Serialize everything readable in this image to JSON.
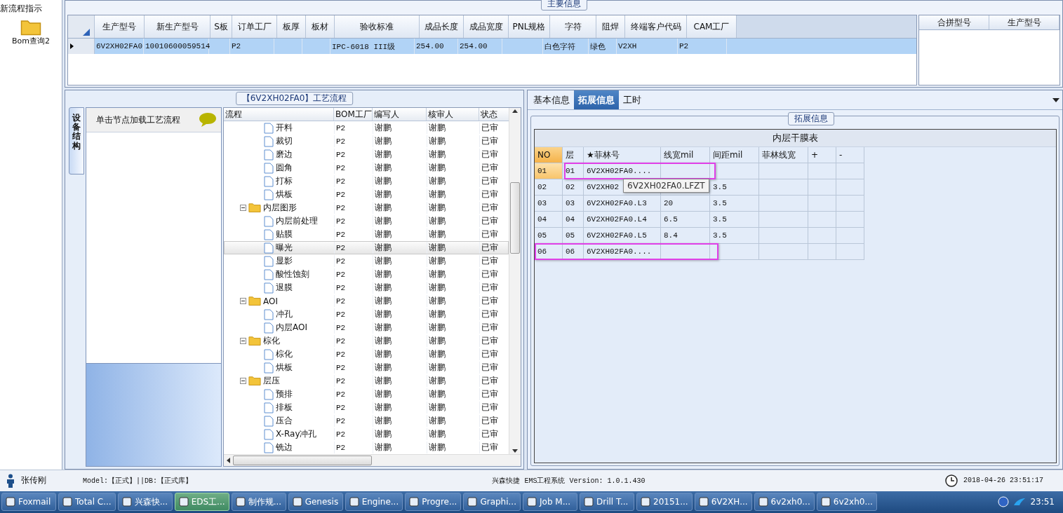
{
  "sidebar": {
    "heading": "新流程指示",
    "items": [
      {
        "label": "Bom查询2"
      }
    ]
  },
  "main_info": {
    "legend": "主要信息",
    "columns": [
      "生产型号",
      "新生产型号",
      "S板",
      "订单工厂",
      "板厚",
      "板材",
      "验收标准",
      "成品长度",
      "成品宽度",
      "PNL规格",
      "字符",
      "阻焊",
      "终端客户代码",
      "CAM工厂"
    ],
    "rows": [
      {
        "selected": true,
        "cells": [
          "6V2XH02FA0",
          "10010600059514",
          null,
          "P2",
          null,
          null,
          "IPC-6018 III级",
          "254.00",
          "254.00",
          null,
          "白色字符",
          "绿色",
          "V2XH",
          "P2"
        ]
      }
    ],
    "side_columns": [
      "合拼型号",
      "生产型号"
    ]
  },
  "process": {
    "legend": "【6V2XH02FA0】工艺流程",
    "side_tab": "设备结构",
    "hint": "单击节点加载工艺流程",
    "columns": [
      "流程",
      "BOM工厂",
      "编写人",
      "核审人",
      "状态"
    ],
    "tree": [
      {
        "kind": "leaf",
        "name": "开料",
        "factory": "P2",
        "author": "谢鹏",
        "reviewer": "谢鹏",
        "status": "已审",
        "selected": false
      },
      {
        "kind": "leaf",
        "name": "裁切",
        "factory": "P2",
        "author": "谢鹏",
        "reviewer": "谢鹏",
        "status": "已审",
        "selected": false
      },
      {
        "kind": "leaf",
        "name": "磨边",
        "factory": "P2",
        "author": "谢鹏",
        "reviewer": "谢鹏",
        "status": "已审",
        "selected": false
      },
      {
        "kind": "leaf",
        "name": "圆角",
        "factory": "P2",
        "author": "谢鹏",
        "reviewer": "谢鹏",
        "status": "已审",
        "selected": false
      },
      {
        "kind": "leaf",
        "name": "打标",
        "factory": "P2",
        "author": "谢鹏",
        "reviewer": "谢鹏",
        "status": "已审",
        "selected": false
      },
      {
        "kind": "leaf",
        "name": "烘板",
        "factory": "P2",
        "author": "谢鹏",
        "reviewer": "谢鹏",
        "status": "已审",
        "selected": false
      },
      {
        "kind": "folder",
        "name": "内层图形",
        "factory": "P2",
        "author": "谢鹏",
        "reviewer": "谢鹏",
        "status": "已审",
        "selected": false,
        "expanded": true,
        "children": [
          {
            "kind": "leaf",
            "name": "内层前处理",
            "factory": "P2",
            "author": "谢鹏",
            "reviewer": "谢鹏",
            "status": "已审",
            "selected": false
          },
          {
            "kind": "leaf",
            "name": "贴膜",
            "factory": "P2",
            "author": "谢鹏",
            "reviewer": "谢鹏",
            "status": "已审",
            "selected": false
          },
          {
            "kind": "leaf",
            "name": "曝光",
            "factory": "P2",
            "author": "谢鹏",
            "reviewer": "谢鹏",
            "status": "已审",
            "selected": true
          },
          {
            "kind": "leaf",
            "name": "显影",
            "factory": "P2",
            "author": "谢鹏",
            "reviewer": "谢鹏",
            "status": "已审",
            "selected": false
          },
          {
            "kind": "leaf",
            "name": "酸性蚀刻",
            "factory": "P2",
            "author": "谢鹏",
            "reviewer": "谢鹏",
            "status": "已审",
            "selected": false
          },
          {
            "kind": "leaf",
            "name": "退膜",
            "factory": "P2",
            "author": "谢鹏",
            "reviewer": "谢鹏",
            "status": "已审",
            "selected": false
          }
        ]
      },
      {
        "kind": "folder",
        "name": "AOI",
        "factory": "P2",
        "author": "谢鹏",
        "reviewer": "谢鹏",
        "status": "已审",
        "selected": false,
        "expanded": true,
        "children": [
          {
            "kind": "leaf",
            "name": "冲孔",
            "factory": "P2",
            "author": "谢鹏",
            "reviewer": "谢鹏",
            "status": "已审",
            "selected": false
          },
          {
            "kind": "leaf",
            "name": "内层AOI",
            "factory": "P2",
            "author": "谢鹏",
            "reviewer": "谢鹏",
            "status": "已审",
            "selected": false
          }
        ]
      },
      {
        "kind": "folder",
        "name": "棕化",
        "factory": "P2",
        "author": "谢鹏",
        "reviewer": "谢鹏",
        "status": "已审",
        "selected": false,
        "expanded": true,
        "children": [
          {
            "kind": "leaf",
            "name": "棕化",
            "factory": "P2",
            "author": "谢鹏",
            "reviewer": "谢鹏",
            "status": "已审",
            "selected": false
          },
          {
            "kind": "leaf",
            "name": "烘板",
            "factory": "P2",
            "author": "谢鹏",
            "reviewer": "谢鹏",
            "status": "已审",
            "selected": false
          }
        ]
      },
      {
        "kind": "folder",
        "name": "层压",
        "factory": "P2",
        "author": "谢鹏",
        "reviewer": "谢鹏",
        "status": "已审",
        "selected": false,
        "expanded": true,
        "children": [
          {
            "kind": "leaf",
            "name": "预排",
            "factory": "P2",
            "author": "谢鹏",
            "reviewer": "谢鹏",
            "status": "已审",
            "selected": false
          },
          {
            "kind": "leaf",
            "name": "排板",
            "factory": "P2",
            "author": "谢鹏",
            "reviewer": "谢鹏",
            "status": "已审",
            "selected": false
          },
          {
            "kind": "leaf",
            "name": "压合",
            "factory": "P2",
            "author": "谢鹏",
            "reviewer": "谢鹏",
            "status": "已审",
            "selected": false
          },
          {
            "kind": "leaf",
            "name": "X-Ray冲孔",
            "factory": "P2",
            "author": "谢鹏",
            "reviewer": "谢鹏",
            "status": "已审",
            "selected": false
          },
          {
            "kind": "leaf",
            "name": "铣边",
            "factory": "P2",
            "author": "谢鹏",
            "reviewer": "谢鹏",
            "status": "已审",
            "selected": false
          }
        ]
      }
    ]
  },
  "detail": {
    "tabs": [
      {
        "label": "基本信息",
        "selected": false
      },
      {
        "label": "拓展信息",
        "selected": true
      },
      {
        "label": "工时",
        "selected": false
      }
    ],
    "legend": "拓展信息",
    "table_title": "内层干膜表",
    "columns": [
      "NO",
      "层",
      "★菲林号",
      "线宽mil",
      "间距mil",
      "菲林线宽",
      "+",
      "-"
    ],
    "rows": [
      {
        "selected": true,
        "highlighted": true,
        "cells": [
          "01",
          "01",
          "6V2XH02FA0....",
          null,
          null,
          null,
          null,
          null
        ]
      },
      {
        "selected": false,
        "highlighted": false,
        "cells": [
          "02",
          "02",
          "6V2XH02",
          null,
          "3.5",
          null,
          null,
          null
        ]
      },
      {
        "selected": false,
        "highlighted": false,
        "cells": [
          "03",
          "03",
          "6V2XH02FA0.L3",
          "20",
          "3.5",
          null,
          null,
          null
        ]
      },
      {
        "selected": false,
        "highlighted": false,
        "cells": [
          "04",
          "04",
          "6V2XH02FA0.L4",
          "6.5",
          "3.5",
          null,
          null,
          null
        ]
      },
      {
        "selected": false,
        "highlighted": false,
        "cells": [
          "05",
          "05",
          "6V2XH02FA0.L5",
          "8.4",
          "3.5",
          null,
          null,
          null
        ]
      },
      {
        "selected": false,
        "highlighted": true,
        "cells": [
          "06",
          "06",
          "6V2XH02FA0....",
          null,
          null,
          null,
          null,
          null
        ]
      }
    ],
    "tooltip": "6V2XH02FA0.LFZT"
  },
  "status_bar": {
    "user": "张传刚",
    "model": "Model:【正式】||DB:【正式库】",
    "app": "兴森快捷 EMS工程系统 Version: 1.0.1.430",
    "datetime": "2018-04-26 23:51:17"
  },
  "taskbar": {
    "items": [
      {
        "label": "Foxmail",
        "selected": false
      },
      {
        "label": "Total C...",
        "selected": false
      },
      {
        "label": "兴森快...",
        "selected": false
      },
      {
        "label": "EDS工...",
        "selected": true
      },
      {
        "label": "制作规...",
        "selected": false
      },
      {
        "label": "Genesis",
        "selected": false
      },
      {
        "label": "Engine...",
        "selected": false
      },
      {
        "label": "Progre...",
        "selected": false
      },
      {
        "label": "Graphi...",
        "selected": false
      },
      {
        "label": "Job M...",
        "selected": false
      },
      {
        "label": "Drill T...",
        "selected": false
      },
      {
        "label": "20151...",
        "selected": false
      },
      {
        "label": "6V2XH...",
        "selected": false
      },
      {
        "label": "6v2xh0...",
        "selected": false
      },
      {
        "label": "6v2xh0...",
        "selected": false
      }
    ],
    "clock": "23:51"
  }
}
